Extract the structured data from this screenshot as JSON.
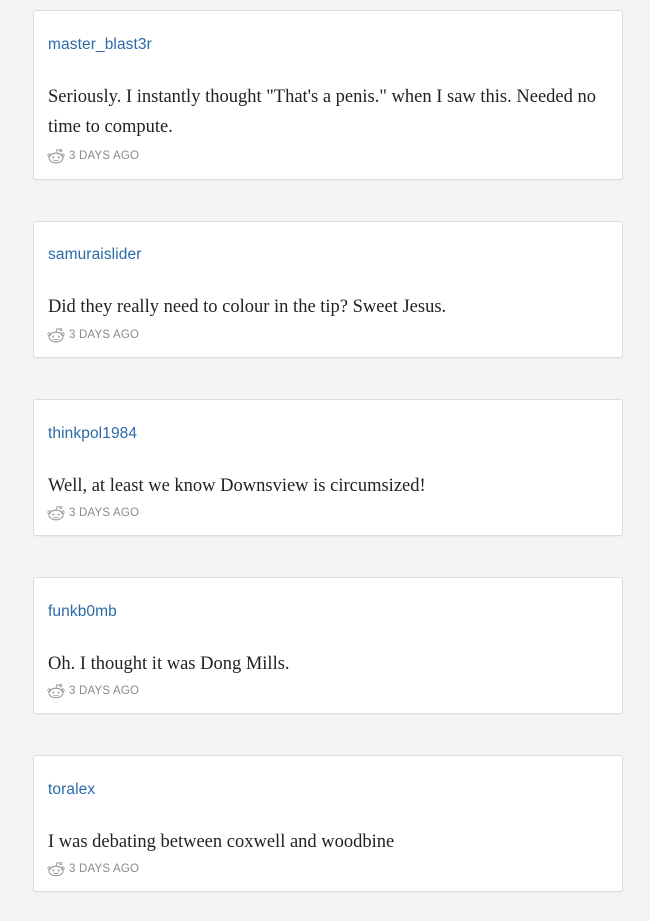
{
  "colors": {
    "username": "#2a6aa8",
    "body_text": "#222222",
    "meta_text": "#8a8a8a",
    "card_border": "#dcdcdc",
    "page_bg": "#f4f4f4"
  },
  "comments": [
    {
      "username": "master_blast3r",
      "text": "Seriously. I instantly thought \"That's a penis.\" when I saw this. Needed no time to compute.",
      "icon": "reddit-alien-icon",
      "time": "3 DAYS AGO"
    },
    {
      "username": "samuraislider",
      "text": "Did they really need to colour in the tip? Sweet Jesus.",
      "icon": "reddit-alien-icon",
      "time": "3 DAYS AGO"
    },
    {
      "username": "thinkpol1984",
      "text": "Well, at least we know Downsview is circumsized!",
      "icon": "reddit-alien-icon",
      "time": "3 DAYS AGO"
    },
    {
      "username": "funkb0mb",
      "text": "Oh. I thought it was Dong Mills.",
      "icon": "reddit-alien-icon",
      "time": "3 DAYS AGO"
    },
    {
      "username": "toralex",
      "text": "I was debating between coxwell and woodbine",
      "icon": "reddit-alien-icon",
      "time": "3 DAYS AGO"
    }
  ]
}
